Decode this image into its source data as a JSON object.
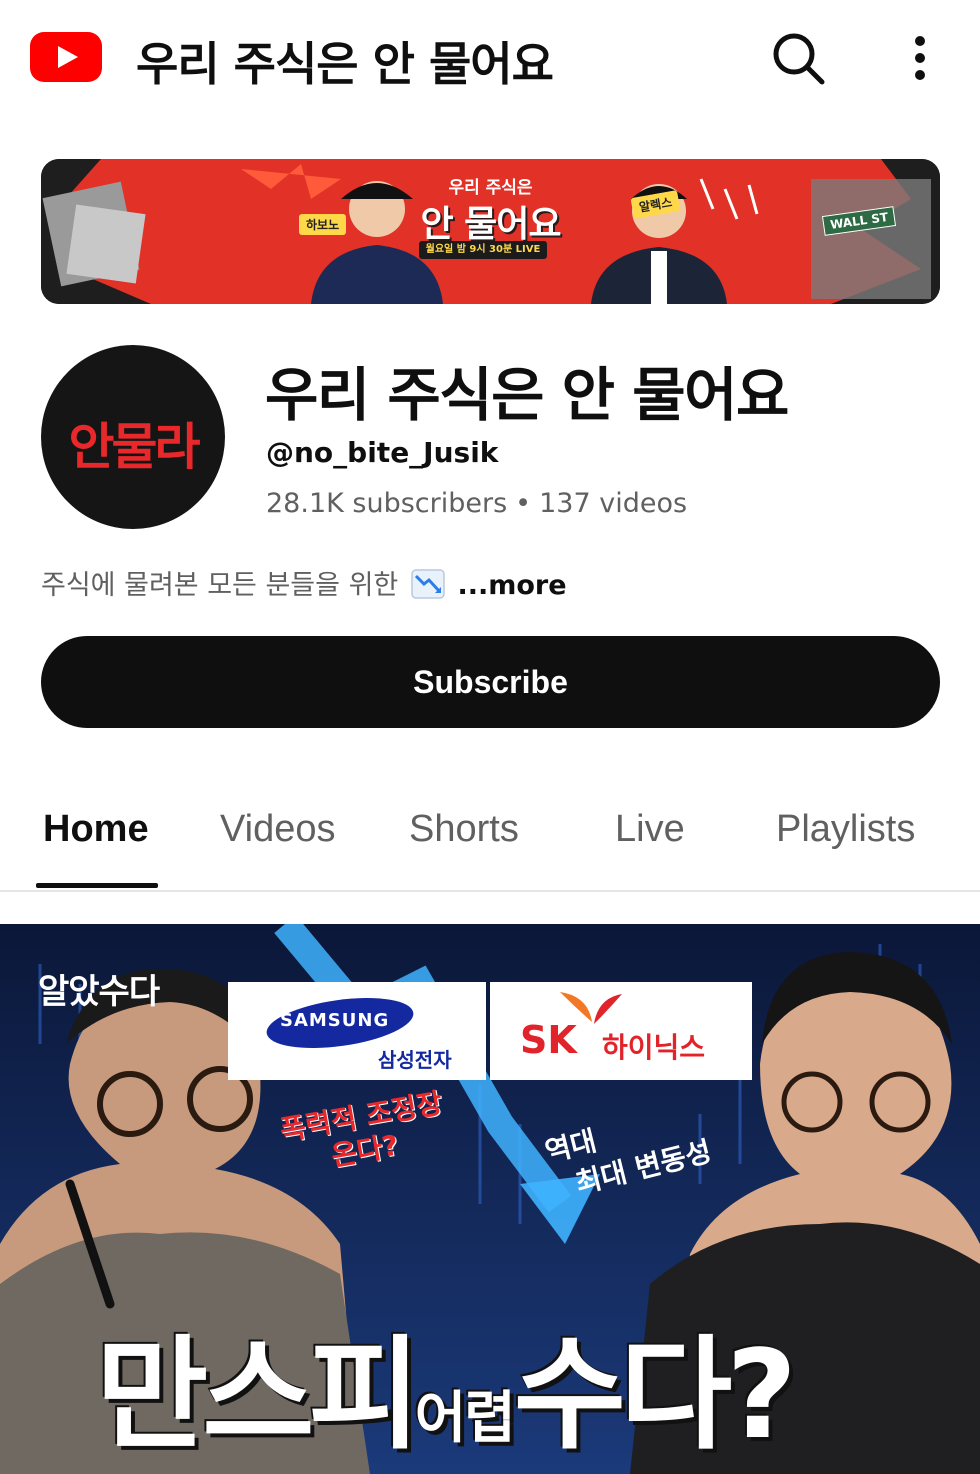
{
  "topbar": {
    "title": "우리 주식은 안 물어요",
    "logo_icon": "youtube-logo",
    "search_icon": "search-icon",
    "more_icon": "more-vertical-icon"
  },
  "banner": {
    "small_title": "우리 주식은",
    "big_title": "안 물어요",
    "schedule": "월요일 밤 9시 30분 LIVE",
    "host_left": "하보노",
    "host_right": "알렉스",
    "street_sign": "WALL ST"
  },
  "channel": {
    "avatar_text": "안물라",
    "name": "우리 주식은 안 물어요",
    "handle": "@no_bite_Jusik",
    "subscribers": "28.1K subscribers",
    "separator": "•",
    "videos": "137 videos",
    "description": "주식에 물려본 모든 분들을 위한",
    "description_icon": "chart-decreasing-icon",
    "more_label": "...more"
  },
  "subscribe": {
    "label": "Subscribe"
  },
  "tabs": [
    {
      "label": "Home",
      "active": true
    },
    {
      "label": "Videos",
      "active": false
    },
    {
      "label": "Shorts",
      "active": false
    },
    {
      "label": "Live",
      "active": false
    },
    {
      "label": "Playlists",
      "active": false
    }
  ],
  "featured": {
    "corner_label": "알았수다",
    "samsung_word": "SAMSUNG",
    "samsung_kor": "삼성전자",
    "sk_word": "SK",
    "sk_kor": "하이닉스",
    "red_text_1": "폭력적 조정장",
    "red_text_2": "온다?",
    "white_text_1": "역대",
    "white_text_2": "최대 변동성",
    "title_big_1": "만스피",
    "title_small": "어렵",
    "title_big_2": "수다?"
  },
  "colors": {
    "youtube_red": "#ff0000",
    "banner_red": "#e8282a",
    "text_primary": "#0f0f0f",
    "text_secondary": "#606060",
    "samsung_blue": "#1428a0"
  }
}
